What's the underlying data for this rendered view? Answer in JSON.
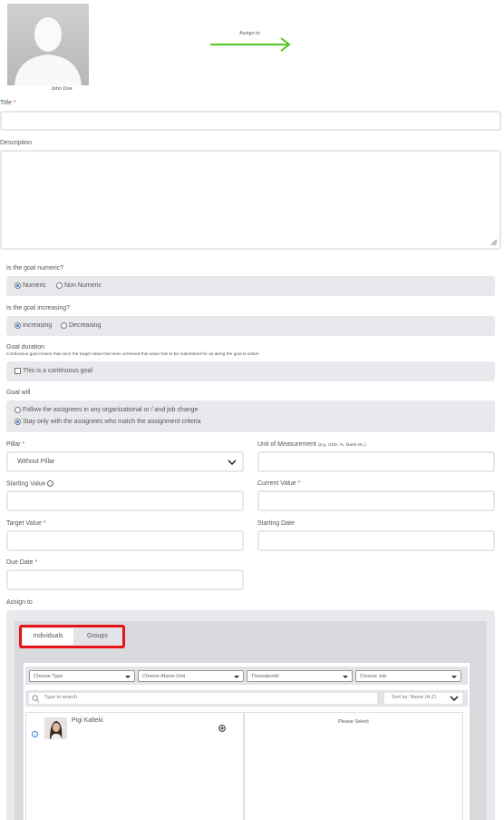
{
  "header": {
    "avatar_name": "John Doe",
    "assign_arrow_label": "Assign to"
  },
  "form": {
    "title_label": "Title",
    "description_label": "Description",
    "numeric_question": "Is the goal numeric?",
    "numeric_options": [
      "Numeric",
      "Non Numeric"
    ],
    "increasing_question": "Is the goal increasing?",
    "increasing_options": [
      "Increasing",
      "Decreasing"
    ],
    "duration_label": "Goal duration",
    "duration_help": "Continuous goal means that once the target value has been achieved this value has to be maintained for as along the goal is active",
    "continuous_label": "This is a continuous goal",
    "goal_will_label": "Goal will",
    "goal_will_options": [
      "Follow the assignees in any organizational or / and job change",
      "Stay only with the assignees who match the assignment criteria"
    ],
    "pillar_label": "Pillar",
    "pillar_value": "Without Pillar",
    "unit_label": "Unit of Measurement",
    "unit_hint": "(e.g. USD, %, blank etc.)",
    "starting_value_label": "Starting Value",
    "current_value_label": "Current Value",
    "target_value_label": "Target Value",
    "starting_date_label": "Starting Date",
    "due_date_label": "Due Date",
    "assign_to_label": "Assign to"
  },
  "assign": {
    "tabs": [
      "Individuals",
      "Groups"
    ],
    "filters": [
      "Choose Type",
      "Choose Above Unit",
      "Thessaloniki",
      "Choose Job"
    ],
    "search_placeholder": "Type to search",
    "sort_label": "Sort by: Name (A-Z)",
    "person_name": "Pigi Kalteki",
    "right_placeholder": "Please Select"
  },
  "colors": {
    "accent_green": "#55c51f",
    "highlight_red": "#e8131a",
    "required_red": "#e0433a"
  }
}
